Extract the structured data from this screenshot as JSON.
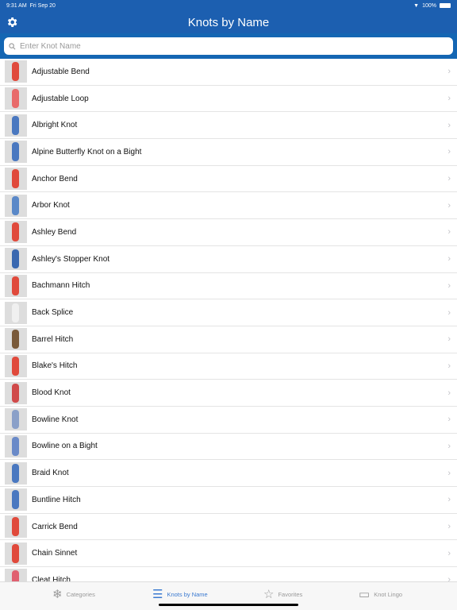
{
  "status": {
    "time": "9:31 AM",
    "date": "Fri Sep 20",
    "battery": "100%"
  },
  "nav": {
    "title": "Knots by Name",
    "settings_icon": "gear-icon"
  },
  "search": {
    "placeholder": "Enter Knot Name",
    "value": ""
  },
  "colors": {
    "brand": "#1c5fb0",
    "accent": "#3b7ad0"
  },
  "knots": [
    {
      "name": "Adjustable Bend",
      "c": "#e04a3c"
    },
    {
      "name": "Adjustable Loop",
      "c": "#e86a6a"
    },
    {
      "name": "Albright Knot",
      "c": "#4a78c0"
    },
    {
      "name": "Alpine Butterfly Knot on a Bight",
      "c": "#4a78c0"
    },
    {
      "name": "Anchor Bend",
      "c": "#e04a3c"
    },
    {
      "name": "Arbor Knot",
      "c": "#5a88c8"
    },
    {
      "name": "Ashley Bend",
      "c": "#e04a3c"
    },
    {
      "name": "Ashley's Stopper Knot",
      "c": "#3a68b0"
    },
    {
      "name": "Bachmann Hitch",
      "c": "#e04a3c"
    },
    {
      "name": "Back Splice",
      "c": "#f0f0f0"
    },
    {
      "name": "Barrel Hitch",
      "c": "#7a5a3a"
    },
    {
      "name": "Blake's Hitch",
      "c": "#e04a3c"
    },
    {
      "name": "Blood Knot",
      "c": "#d04a4a"
    },
    {
      "name": "Bowline Knot",
      "c": "#8aa0c8"
    },
    {
      "name": "Bowline on a Bight",
      "c": "#6a8ac8"
    },
    {
      "name": "Braid Knot",
      "c": "#4a78c0"
    },
    {
      "name": "Buntline Hitch",
      "c": "#4a78c0"
    },
    {
      "name": "Carrick Bend",
      "c": "#e04a3c"
    },
    {
      "name": "Chain Sinnet",
      "c": "#e04a3c"
    },
    {
      "name": "Cleat Hitch",
      "c": "#e06070"
    }
  ],
  "tabs": [
    {
      "label": "Categories",
      "icon": "knot-icon"
    },
    {
      "label": "Knots by Name",
      "icon": "list-icon",
      "active": true
    },
    {
      "label": "Favorites",
      "icon": "star-icon"
    },
    {
      "label": "Knot Lingo",
      "icon": "book-icon"
    }
  ]
}
